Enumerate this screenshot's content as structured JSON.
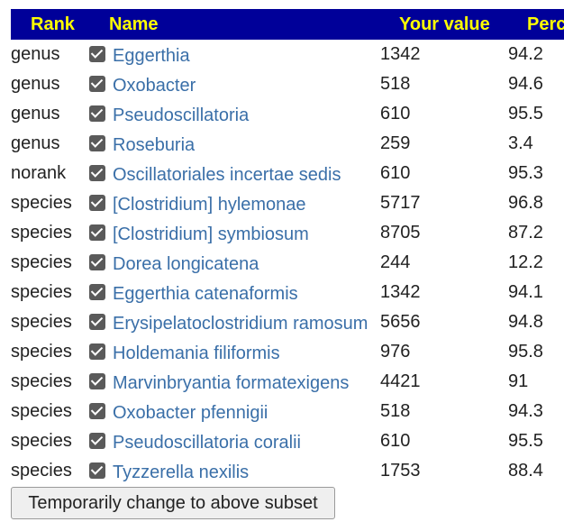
{
  "table": {
    "headers": {
      "rank": "Rank",
      "name": "Name",
      "your_value": "Your value",
      "percentile": "Perc"
    },
    "rows": [
      {
        "rank": "genus",
        "checked": true,
        "name": "Eggerthia",
        "value": "1342",
        "percentile": "94.2"
      },
      {
        "rank": "genus",
        "checked": true,
        "name": "Oxobacter",
        "value": "518",
        "percentile": "94.6"
      },
      {
        "rank": "genus",
        "checked": true,
        "name": "Pseudoscillatoria",
        "value": "610",
        "percentile": "95.5"
      },
      {
        "rank": "genus",
        "checked": true,
        "name": "Roseburia",
        "value": "259",
        "percentile": "3.4"
      },
      {
        "rank": "norank",
        "checked": true,
        "name": "Oscillatoriales incertae sedis",
        "value": "610",
        "percentile": "95.3"
      },
      {
        "rank": "species",
        "checked": true,
        "name": "[Clostridium] hylemonae",
        "value": "5717",
        "percentile": "96.8"
      },
      {
        "rank": "species",
        "checked": true,
        "name": "[Clostridium] symbiosum",
        "value": "8705",
        "percentile": "87.2"
      },
      {
        "rank": "species",
        "checked": true,
        "name": "Dorea longicatena",
        "value": "244",
        "percentile": "12.2"
      },
      {
        "rank": "species",
        "checked": true,
        "name": "Eggerthia catenaformis",
        "value": "1342",
        "percentile": "94.1"
      },
      {
        "rank": "species",
        "checked": true,
        "name": "Erysipelatoclostridium ramosum",
        "value": "5656",
        "percentile": "94.8"
      },
      {
        "rank": "species",
        "checked": true,
        "name": "Holdemania filiformis",
        "value": "976",
        "percentile": "95.8"
      },
      {
        "rank": "species",
        "checked": true,
        "name": "Marvinbryantia formatexigens",
        "value": "4421",
        "percentile": "91"
      },
      {
        "rank": "species",
        "checked": true,
        "name": "Oxobacter pfennigii",
        "value": "518",
        "percentile": "94.3"
      },
      {
        "rank": "species",
        "checked": true,
        "name": "Pseudoscillatoria coralii",
        "value": "610",
        "percentile": "95.5"
      },
      {
        "rank": "species",
        "checked": true,
        "name": "Tyzzerella nexilis",
        "value": "1753",
        "percentile": "88.4"
      }
    ]
  },
  "actions": {
    "subset_button_label": "Temporarily change to above subset"
  },
  "colors": {
    "header_bg": "#000099",
    "header_text": "#ffff00",
    "link": "#3a6fa8"
  }
}
